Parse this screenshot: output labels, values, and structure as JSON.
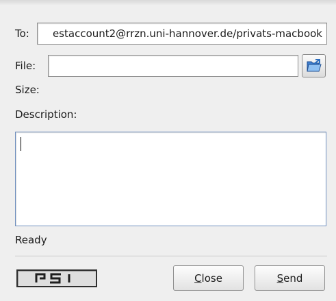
{
  "form": {
    "to_label": "To:",
    "to_value": "estaccount2@rrzn.uni-hannover.de/privats-macbook",
    "file_label": "File:",
    "file_value": "",
    "size_label": "Size:",
    "description_label": "Description:",
    "description_value": ""
  },
  "status": {
    "text": "Ready"
  },
  "logo": {
    "text": "PSI"
  },
  "buttons": {
    "close_mnemonic": "C",
    "close_rest": "lose",
    "send_mnemonic": "S",
    "send_rest": "end"
  },
  "icons": {
    "browse": "folder-open-icon"
  }
}
